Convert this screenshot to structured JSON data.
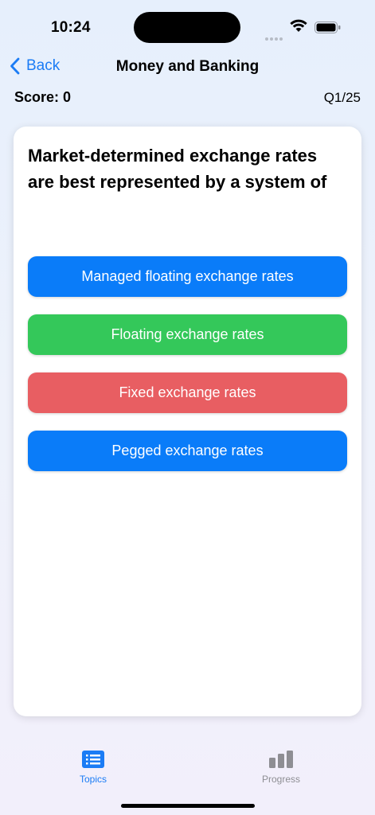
{
  "status": {
    "time": "10:24"
  },
  "nav": {
    "back_label": "Back",
    "title": "Money and Banking"
  },
  "header": {
    "score": "Score: 0",
    "question_count": "Q1/25"
  },
  "quiz": {
    "question": "Market-determined exchange rates are best represented by a system of",
    "options": [
      {
        "label": "Managed floating exchange rates",
        "state": "default",
        "color": "#0a7cf9"
      },
      {
        "label": "Floating exchange rates",
        "state": "correct",
        "color": "#34c85a"
      },
      {
        "label": "Fixed exchange rates",
        "state": "incorrect",
        "color": "#e85e62"
      },
      {
        "label": "Pegged exchange rates",
        "state": "default",
        "color": "#0a7cf9"
      }
    ]
  },
  "tabs": [
    {
      "label": "Topics",
      "icon": "list-icon",
      "selected": true,
      "color": "#1b7cf5"
    },
    {
      "label": "Progress",
      "icon": "bar-chart-icon",
      "selected": false,
      "color": "#8e8e93"
    }
  ]
}
